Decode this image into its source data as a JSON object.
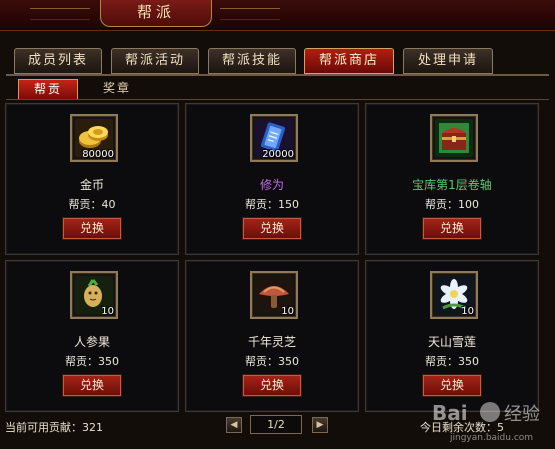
{
  "window": {
    "title": "帮派"
  },
  "tabs": [
    {
      "label": "成员列表",
      "active": false
    },
    {
      "label": "帮派活动",
      "active": false
    },
    {
      "label": "帮派技能",
      "active": false
    },
    {
      "label": "帮派商店",
      "active": true
    },
    {
      "label": "处理申请",
      "active": false
    }
  ],
  "subtabs": [
    {
      "label": "帮贡",
      "active": true
    },
    {
      "label": "奖章",
      "active": false
    }
  ],
  "items": [
    {
      "name": "金币",
      "qty": "80000",
      "cost": "帮贡：40",
      "button": "兑换",
      "icon": "gold-coins-icon",
      "name_color": "#f0eadc"
    },
    {
      "name": "修为",
      "qty": "20000",
      "cost": "帮贡：150",
      "button": "兑换",
      "icon": "cultivation-scroll-icon",
      "name_color": "#c26be8"
    },
    {
      "name": "宝库第1层卷轴",
      "qty": "",
      "cost": "帮贡：100",
      "button": "兑换",
      "icon": "treasure-chest-icon",
      "name_color": "#5ec872"
    },
    {
      "name": "人参果",
      "qty": "10",
      "cost": "帮贡：350",
      "button": "兑换",
      "icon": "ginseng-fruit-icon",
      "name_color": "#f0eadc"
    },
    {
      "name": "千年灵芝",
      "qty": "10",
      "cost": "帮贡：350",
      "button": "兑换",
      "icon": "lingzhi-mushroom-icon",
      "name_color": "#f0eadc"
    },
    {
      "name": "天山雪莲",
      "qty": "10",
      "cost": "帮贡：350",
      "button": "兑换",
      "icon": "snow-lotus-icon",
      "name_color": "#f0eadc"
    }
  ],
  "footer": {
    "available_contribution": "当前可用贡献：321",
    "page": "1/2",
    "remaining": "今日剩余次数：5",
    "prev_icon": "arrow-left-icon",
    "next_icon": "arrow-right-icon"
  },
  "watermark": {
    "text": "Bai 经验",
    "sub": "jingyan.baidu.com"
  }
}
